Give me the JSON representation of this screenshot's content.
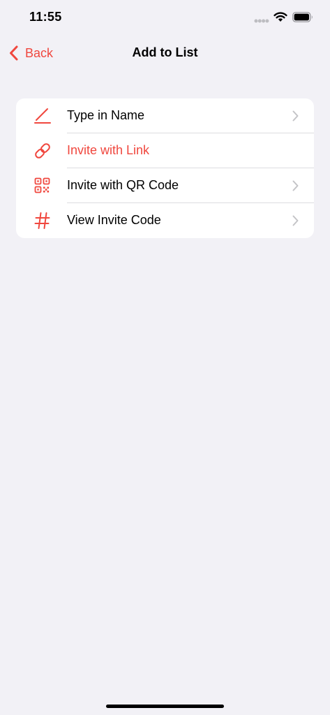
{
  "status_bar": {
    "time": "11:55"
  },
  "nav": {
    "back_label": "Back",
    "title": "Add to List"
  },
  "menu": {
    "items": [
      {
        "label": "Type in Name",
        "icon": "pencil-icon",
        "has_chevron": true,
        "accent": false
      },
      {
        "label": "Invite with Link",
        "icon": "link-icon",
        "has_chevron": false,
        "accent": true
      },
      {
        "label": "Invite with QR Code",
        "icon": "qr-code-icon",
        "has_chevron": true,
        "accent": false
      },
      {
        "label": "View Invite Code",
        "icon": "hashtag-icon",
        "has_chevron": true,
        "accent": false
      }
    ]
  },
  "colors": {
    "accent": "#f0473e",
    "background": "#f2f1f6",
    "card": "#ffffff",
    "chevron": "#c4c4c7"
  }
}
